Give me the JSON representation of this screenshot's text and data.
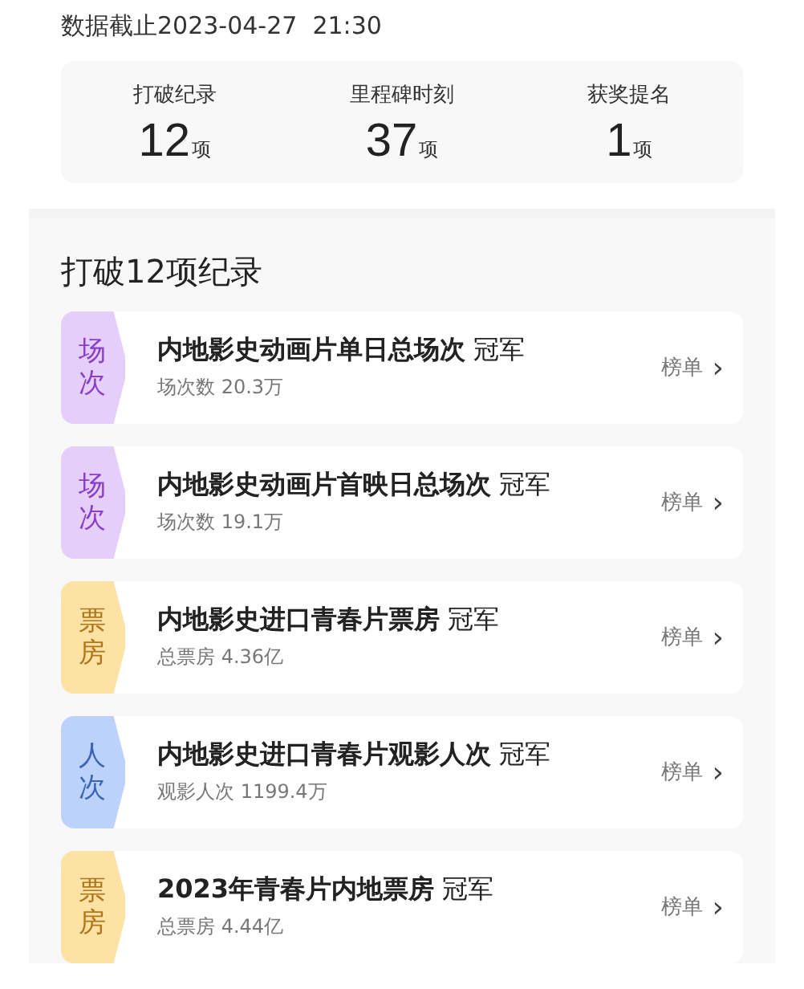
{
  "updated": "数据截止2023-04-27  21:30",
  "stats": [
    {
      "label": "打破纪录",
      "value": "12",
      "unit": "项"
    },
    {
      "label": "里程碑时刻",
      "value": "37",
      "unit": "项"
    },
    {
      "label": "获奖提名",
      "value": "1",
      "unit": "项"
    }
  ],
  "records_title": "打破12项纪录",
  "records": [
    {
      "kind": "screenings",
      "tag": "场次",
      "title": "**内地影史动画片单日总场次** 冠军",
      "detail": "场次数 20.3万",
      "link": "榜单",
      "chevron": "›"
    },
    {
      "kind": "screenings",
      "tag": "场次",
      "title": "**内地影史动画片首映日总场次** 冠军",
      "detail": "场次数 19.1万",
      "link": "榜单",
      "chevron": "›"
    },
    {
      "kind": "boxoffice",
      "tag": "票房",
      "title": "**内地影史进口青春片票房** 冠军",
      "detail": "总票房 4.36亿",
      "link": "榜单",
      "chevron": "›"
    },
    {
      "kind": "admissions",
      "tag": "人次",
      "title": "**内地影史进口青春片观影人次** 冠军",
      "detail": "观影人次 1199.4万",
      "link": "榜单",
      "chevron": "›"
    },
    {
      "kind": "boxoffice",
      "tag": "票房",
      "title": "**2023年青春片内地票房** 冠军",
      "detail": "总票房 4.44亿",
      "link": "榜单",
      "chevron": "›"
    }
  ]
}
